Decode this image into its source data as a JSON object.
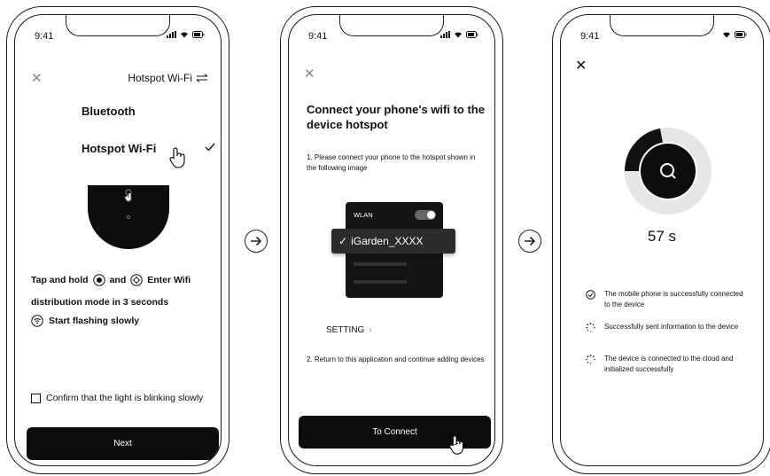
{
  "screens": {
    "s1": {
      "time": "9:41",
      "header_title": "Hotspot Wi-Fi",
      "option_bluetooth": "Bluetooth",
      "option_hotspot": "Hotspot Wi-Fi",
      "instruction_a": "Tap and hold",
      "instruction_and": "and",
      "instruction_b": "Enter Wifi",
      "instruction_line2": "distribution mode in 3 seconds",
      "instruction_flash": "Start flashing slowly",
      "confirm_label": "Confirm that the light is blinking slowly",
      "next_button": "Next"
    },
    "s2": {
      "time": "9:41",
      "title": "Connect your phone's wifi to the device hotspot",
      "step1": "1. Please connect your phone to the hotspot shown in the following image",
      "wlan_label": "WLAN",
      "network_name": "iGarden_XXXX",
      "setting_link": "SETTING",
      "step2": "2. Return to this application and continue adding devices",
      "connect_button": "To Connect"
    },
    "s3": {
      "time": "9:41",
      "countdown": "57 s",
      "progress_fraction": 0.22,
      "steps": [
        {
          "text": "The mobile phone is successfully connected to the device",
          "state": "done"
        },
        {
          "text": "Successfully sent information to the device",
          "state": "loading"
        },
        {
          "text": "The device is connected to the cloud and initialized successfully",
          "state": "loading"
        }
      ]
    }
  },
  "icons": [
    "close-icon",
    "swap-icon",
    "checkmark-icon",
    "hand-pointer-icon",
    "arrow-right-circle-icon",
    "wifi-icon",
    "battery-icon",
    "signal-icon",
    "search-icon",
    "check-circle-icon",
    "spinner-icon"
  ]
}
